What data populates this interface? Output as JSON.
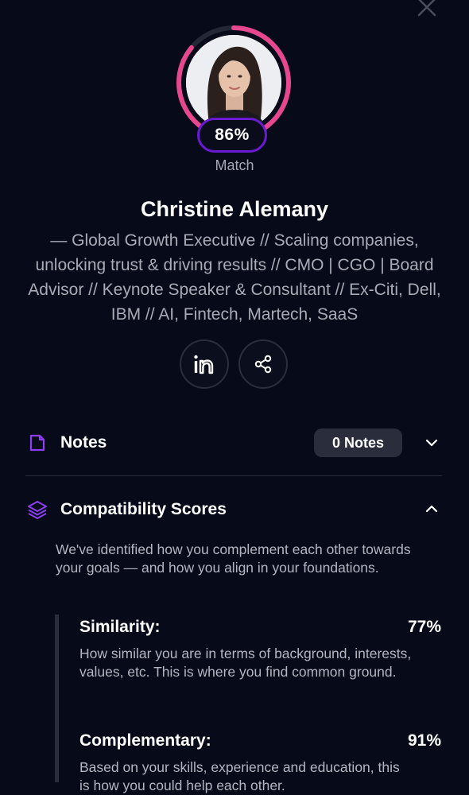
{
  "profile": {
    "name": "Christine Alemany",
    "headline": "— Global Growth Executive // Scaling companies, unlocking trust & driving results // CMO | CGO | Board Advisor // Keynote Speaker & Consultant // Ex-Citi, Dell, IBM // AI, Fintech, Martech, SaaS",
    "match_percent": "86%",
    "match_fraction": 0.86,
    "match_label": "Match"
  },
  "actions": {
    "linkedin_icon": "linkedin-icon",
    "share_icon": "share-icon"
  },
  "notes": {
    "title": "Notes",
    "badge": "0 Notes"
  },
  "compatibility": {
    "title": "Compatibility Scores",
    "description": "We've identified how you complement each other towards your goals — and how you align in your foundations.",
    "scores": [
      {
        "title": "Similarity:",
        "value": "77%",
        "description": "How similar you are in terms of background, interests, values, etc. This is where you find common ground."
      },
      {
        "title": "Complementary:",
        "value": "91%",
        "description": "Based on your skills, experience and education, this is how you could help each other."
      }
    ]
  },
  "colors": {
    "background": "#070a18",
    "ring_accent": "#e7478f",
    "pill_border": "#6a1bd1",
    "icon_purple": "#8b3ff0"
  }
}
